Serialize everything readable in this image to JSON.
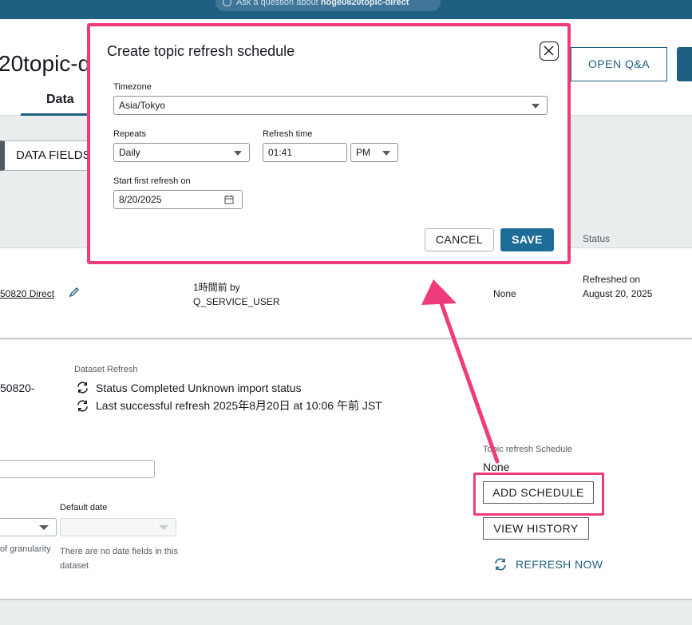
{
  "topbar": {
    "ask_prefix": "Ask a question about ",
    "ask_topic": "hoge0820topic-direct"
  },
  "header": {
    "title_clipped": "20topic-d",
    "tab_data": "Data",
    "open_qa": "OPEN Q&A"
  },
  "data_fields_tab": "DATA FIELDS",
  "table": {
    "status_header": "Status",
    "row": {
      "dataset_name_clipped": "50820 Direct",
      "updated_line1": "1時間前 by",
      "updated_line2": "Q_SERVICE_USER",
      "schedule": "None",
      "status": "Refreshed on August 20, 2025"
    }
  },
  "details": {
    "left_clipped": "50820-",
    "dataset_refresh_label": "Dataset Refresh",
    "status_line": "Status  Completed  Unknown import status",
    "last_refresh_line": "Last successful refresh  2025年8月20日 at 10:06 午前 JST",
    "default_date_label": "Default date",
    "granularity_note_clipped": "of granularity",
    "no_date_note": "There are no date fields in this dataset",
    "topic_refresh_schedule_label": "Topic refresh Schedule",
    "topic_refresh_schedule_value": "None",
    "add_schedule": "ADD SCHEDULE",
    "view_history": "VIEW HISTORY",
    "refresh_now": "REFRESH NOW"
  },
  "modal": {
    "title": "Create topic refresh schedule",
    "timezone_label": "Timezone",
    "timezone_value": "Asia/Tokyo",
    "repeats_label": "Repeats",
    "repeats_value": "Daily",
    "refresh_time_label": "Refresh time",
    "refresh_time_value": "01:41",
    "ampm_value": "PM",
    "start_label": "Start first refresh on",
    "start_value": "8/20/2025",
    "cancel": "CANCEL",
    "save": "SAVE"
  },
  "colors": {
    "accent": "#1f5f82",
    "highlight": "#ef3b7c",
    "save": "#1f6c99"
  },
  "icons": [
    "question-icon",
    "pencil-icon",
    "refresh-icon",
    "close-icon",
    "calendar-icon",
    "chevron-down-icon",
    "annotation-arrow"
  ]
}
